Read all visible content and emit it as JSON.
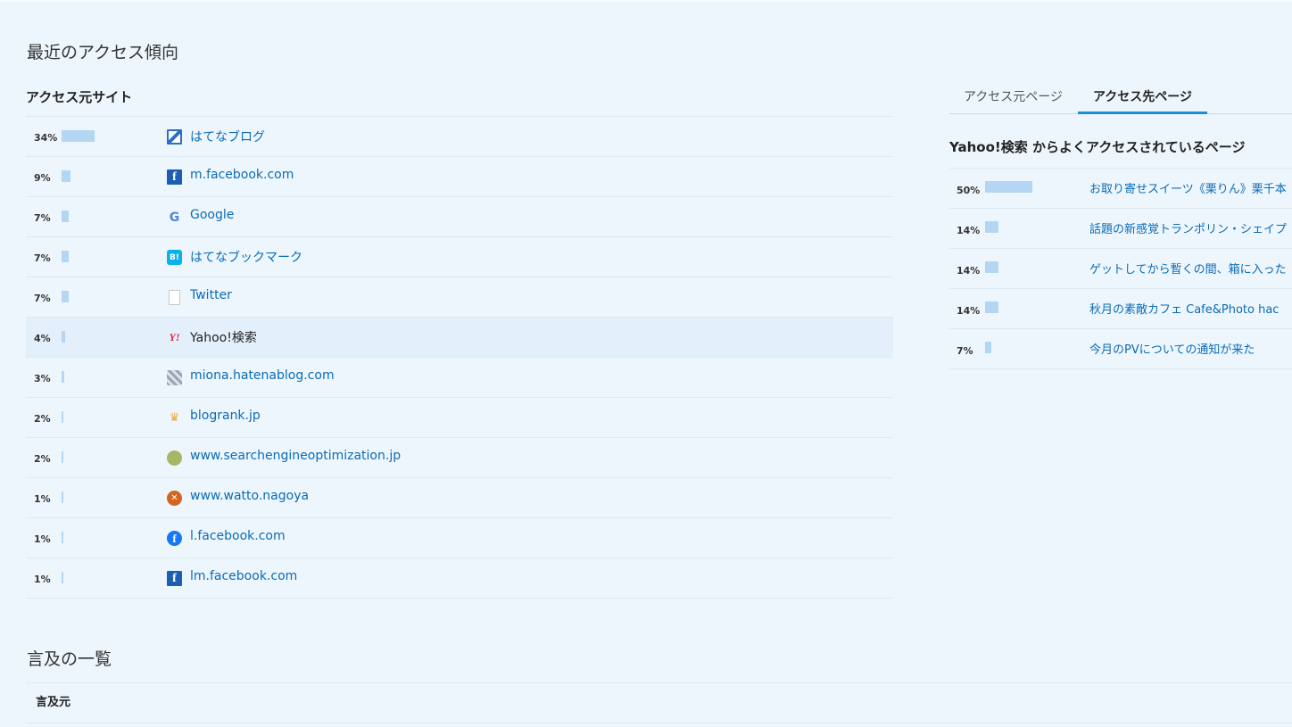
{
  "section_recent_title": "最近のアクセス傾向",
  "referrers": {
    "heading": "アクセス元サイト",
    "items": [
      {
        "pct": "34%",
        "value": 34,
        "name": "はてなブログ",
        "icon": "hatena-blog-icon"
      },
      {
        "pct": "9%",
        "value": 9,
        "name": "m.facebook.com",
        "icon": "facebook-icon"
      },
      {
        "pct": "7%",
        "value": 7,
        "name": "Google",
        "icon": "google-icon"
      },
      {
        "pct": "7%",
        "value": 7,
        "name": "はてなブックマーク",
        "icon": "hatena-bookmark-icon"
      },
      {
        "pct": "7%",
        "value": 7,
        "name": "Twitter",
        "icon": "document-icon"
      },
      {
        "pct": "4%",
        "value": 4,
        "name": "Yahoo!検索",
        "icon": "yahoo-icon",
        "highlighted": true
      },
      {
        "pct": "3%",
        "value": 3,
        "name": "miona.hatenablog.com",
        "icon": "blog-avatar-icon"
      },
      {
        "pct": "2%",
        "value": 2,
        "name": "blogrank.jp",
        "icon": "crown-icon"
      },
      {
        "pct": "2%",
        "value": 2,
        "name": "www.searchengineoptimization.jp",
        "icon": "leaf-icon"
      },
      {
        "pct": "1%",
        "value": 1,
        "name": "www.watto.nagoya",
        "icon": "watto-icon"
      },
      {
        "pct": "1%",
        "value": 1,
        "name": "l.facebook.com",
        "icon": "facebook-circle-icon"
      },
      {
        "pct": "1%",
        "value": 1,
        "name": "lm.facebook.com",
        "icon": "facebook-icon"
      }
    ]
  },
  "tabs": {
    "source_label": "アクセス元ページ",
    "dest_label": "アクセス先ページ",
    "active": "dest"
  },
  "destination": {
    "heading": "Yahoo!検索 からよくアクセスされているページ",
    "items": [
      {
        "pct": "50%",
        "value": 50,
        "title": "お取り寄せスイーツ《栗りん》栗千本"
      },
      {
        "pct": "14%",
        "value": 14,
        "title": "話題の新感覚トランポリン・シェイプ"
      },
      {
        "pct": "14%",
        "value": 14,
        "title": "ゲットしてから暫くの間、箱に入った"
      },
      {
        "pct": "14%",
        "value": 14,
        "title": "秋月の素敵カフェ Cafe&Photo hac"
      },
      {
        "pct": "7%",
        "value": 7,
        "title": "今月のPVについての通知が来た"
      }
    ]
  },
  "mentions": {
    "title": "言及の一覧",
    "column_header": "言及元"
  },
  "colors": {
    "background": "#eef6fd",
    "bar": "#b5d6f2",
    "link": "#0a6bb5",
    "tab_active": "#1b8fd6",
    "row_highlight": "#e3effb"
  }
}
